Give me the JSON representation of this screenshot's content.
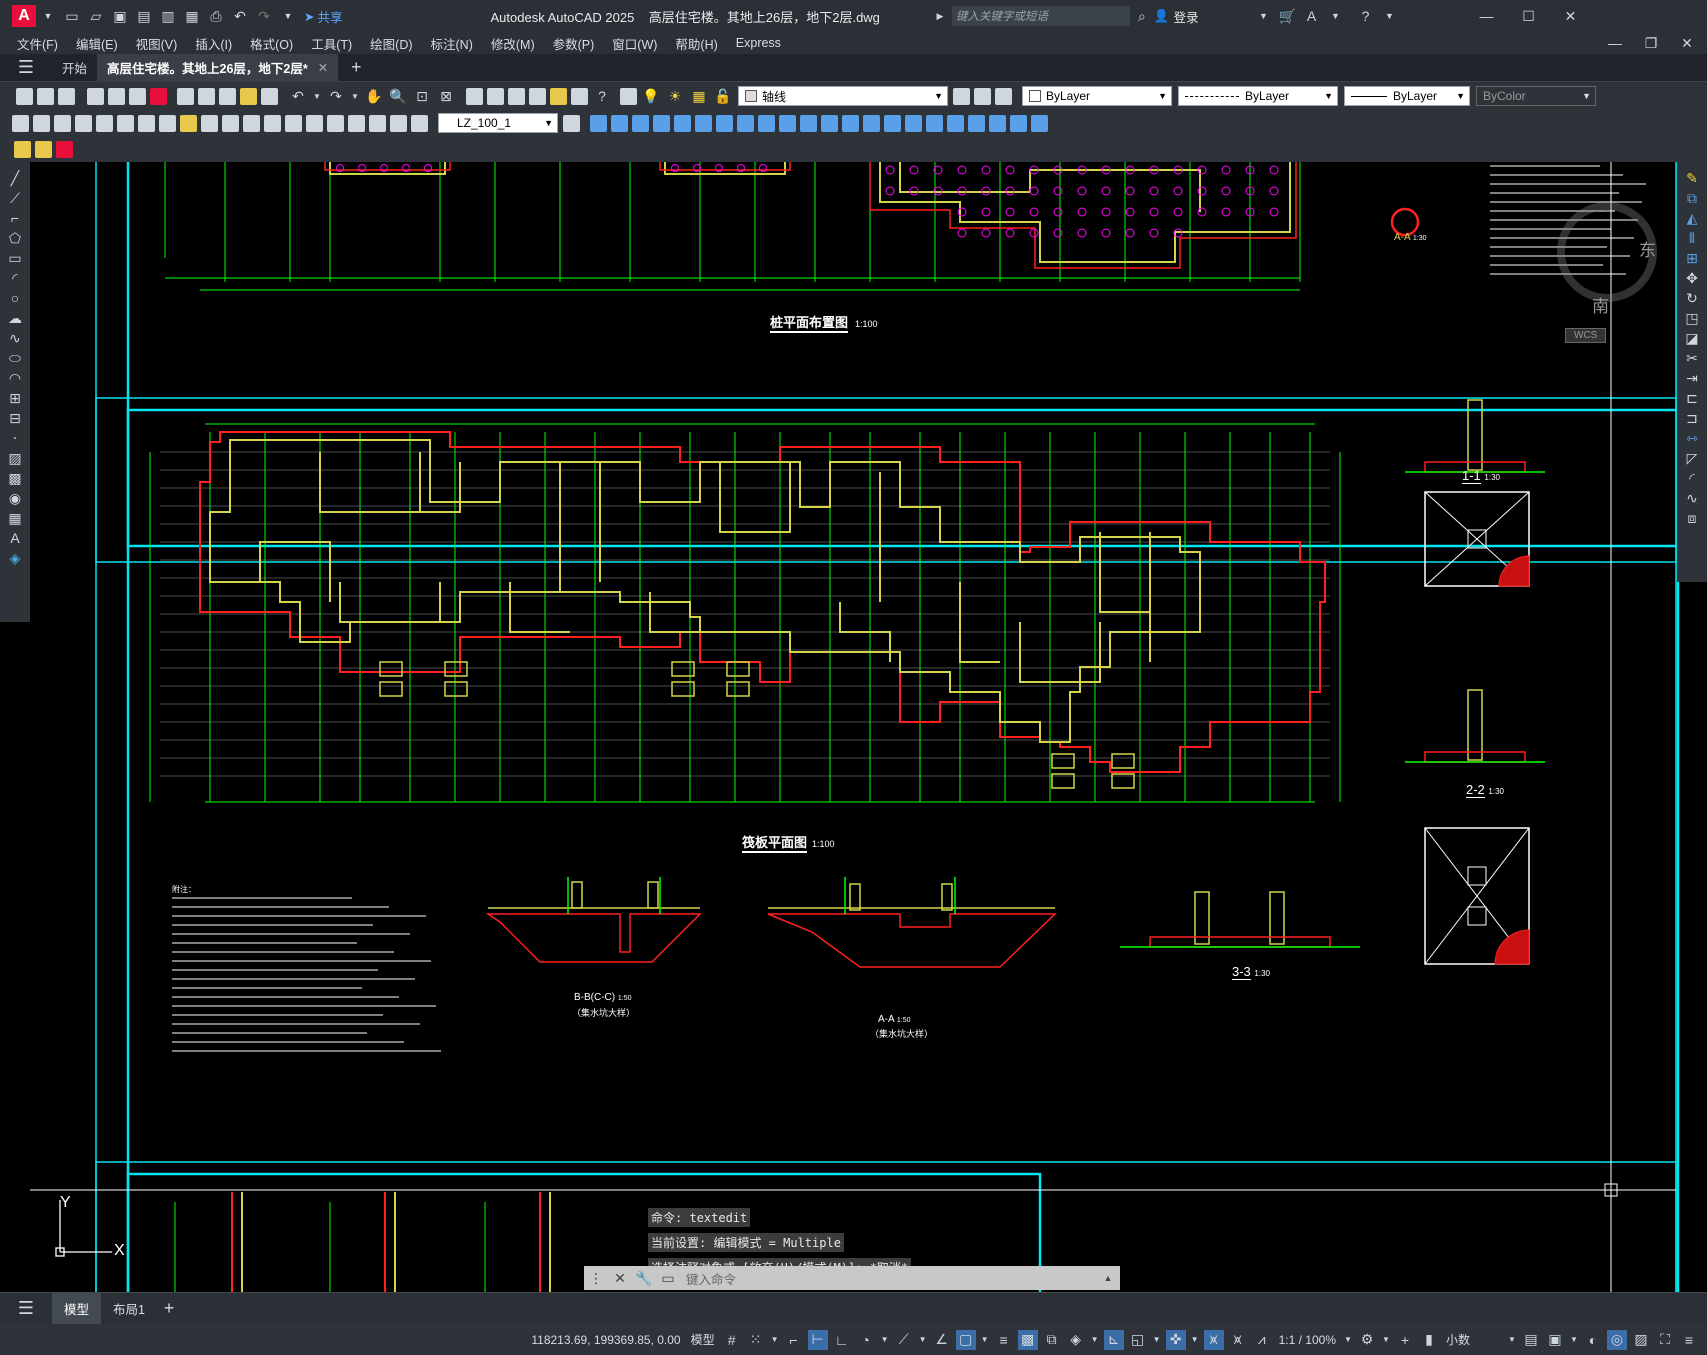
{
  "app": {
    "title": "Autodesk AutoCAD 2025    高层住宅楼。其地上26层，地下2层.dwg",
    "share_label": "共享",
    "search_placeholder": "键入关键字或短语",
    "login_label": "登录"
  },
  "menus": [
    "文件(F)",
    "编辑(E)",
    "视图(V)",
    "插入(I)",
    "格式(O)",
    "工具(T)",
    "绘图(D)",
    "标注(N)",
    "修改(M)",
    "参数(P)",
    "窗口(W)",
    "帮助(H)",
    "Express"
  ],
  "tabs": {
    "start": "开始",
    "file": "高层住宅楼。其地上26层，地下2层*"
  },
  "toolbar": {
    "layer_value": "轴线",
    "color_value": "ByLayer",
    "linetype_value": "ByLayer",
    "lineweight_value": "ByLayer",
    "plotstyle_value": "ByColor",
    "dimstyle_value": "LZ_100_1"
  },
  "drawing": {
    "pile_plan_title": "桩平面布置图",
    "pile_plan_scale": "1:100",
    "raft_plan_title": "筏板平面图",
    "raft_plan_scale": "1:100",
    "sec_aa_small": "A-A",
    "sec_aa_small_scale": "1:30",
    "sec_11": "1-1",
    "sec_11_scale": "1:30",
    "sec_22": "2-2",
    "sec_22_scale": "1:30",
    "sec_33": "3-3",
    "sec_33_scale": "1:30",
    "sec_bb": "B-B(C-C)",
    "sec_bb_scale": "1:50",
    "sec_bb_note": "（集水坑大样）",
    "sec_aa": "A-A",
    "sec_aa_scale": "1:50",
    "sec_aa_note": "（集水坑大样）",
    "notes_title": "附注：",
    "viewcube_east": "东",
    "viewcube_south": "南",
    "wcs_label": "WCS",
    "ucs_y": "Y",
    "ucs_x": "X"
  },
  "command": {
    "history": [
      "命令:  textedit",
      "当前设置: 编辑模式 = Multiple",
      "选择注释对象或 [放弃(U)/模式(M)]: *取消*"
    ],
    "placeholder": "键入命令"
  },
  "layout_tabs": [
    "模型",
    "布局1"
  ],
  "status": {
    "coords": "118213.69, 199369.85, 0.00",
    "model_label": "模型",
    "scale": "1:1 / 100%",
    "units": "小数"
  },
  "colors": {
    "accent": "#e8103a",
    "frame_cyan": "#00e5ee",
    "grid_green": "#00ff00",
    "wall_yellow": "#d4d44a",
    "raft_red": "#ff2020",
    "pile_magenta": "#ff00ff"
  }
}
